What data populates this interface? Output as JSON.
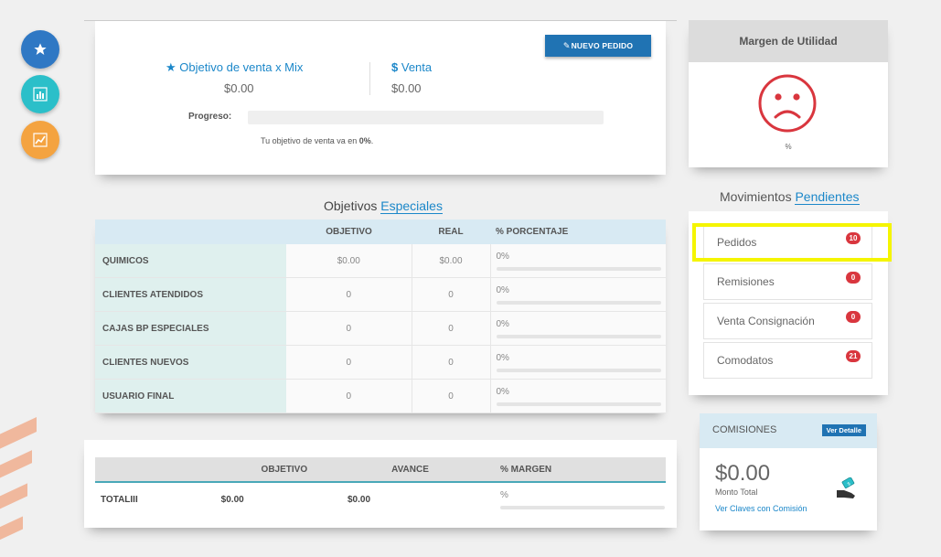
{
  "colors": {
    "accent_blue": "#1b87c9",
    "button_blue": "#2073b3",
    "fab_star": "#2f78c4",
    "fab_bars": "#2bbfc9",
    "fab_trend": "#f4a340",
    "badge_red": "#d9363e",
    "sad_face": "#d9363e",
    "highlight": "#f5f500"
  },
  "fabs": [
    {
      "icon": "star-icon"
    },
    {
      "icon": "bar-chart-icon"
    },
    {
      "icon": "line-chart-icon"
    }
  ],
  "summary": {
    "objetivo_label": "Objetivo de venta x Mix",
    "objetivo_value": "$0.00",
    "venta_label": "Venta",
    "venta_value": "$0.00",
    "progreso_label": "Progreso:",
    "progress_value": 0,
    "progress_text_prefix": "Tu objetivo de venta va en ",
    "progress_text_value": "0%",
    "progress_text_suffix": ".",
    "nuevo_pedido_label": "NUEVO PEDIDO"
  },
  "objetivos": {
    "title_plain": "Objetivos ",
    "title_link": "Especiales",
    "headers": [
      "",
      "OBJETIVO",
      "REAL",
      "% PORCENTAJE"
    ],
    "rows": [
      {
        "name": "QUIMICOS",
        "objetivo": "$0.00",
        "real": "$0.00",
        "pct": "0%"
      },
      {
        "name": "CLIENTES ATENDIDOS",
        "objetivo": "0",
        "real": "0",
        "pct": "0%"
      },
      {
        "name": "CAJAS BP ESPECIALES",
        "objetivo": "0",
        "real": "0",
        "pct": "0%"
      },
      {
        "name": "CLIENTES NUEVOS",
        "objetivo": "0",
        "real": "0",
        "pct": "0%"
      },
      {
        "name": "USUARIO FINAL",
        "objetivo": "0",
        "real": "0",
        "pct": "0%"
      }
    ]
  },
  "totales": {
    "headers": [
      "",
      "OBJETIVO",
      "AVANCE",
      "% MARGEN"
    ],
    "row": {
      "name": "TOTALIII",
      "objetivo": "$0.00",
      "avance": "$0.00",
      "margen": "%"
    }
  },
  "margen": {
    "title": "Margen de Utilidad",
    "icon": "sad-face-icon",
    "value": "%"
  },
  "movimientos": {
    "title_plain": "Movimientos ",
    "title_link": "Pendientes",
    "items": [
      {
        "label": "Pedidos",
        "count": "10"
      },
      {
        "label": "Remisiones",
        "count": "0"
      },
      {
        "label": "Venta Consignación",
        "count": "0"
      },
      {
        "label": "Comodatos",
        "count": "21"
      }
    ]
  },
  "comisiones": {
    "title": "COMISIONES",
    "detalle_label": "Ver Detalle",
    "amount": "$0.00",
    "amount_caption": "Monto Total",
    "link": "Ver Claves con Comisión",
    "icon": "money-hand-icon"
  }
}
